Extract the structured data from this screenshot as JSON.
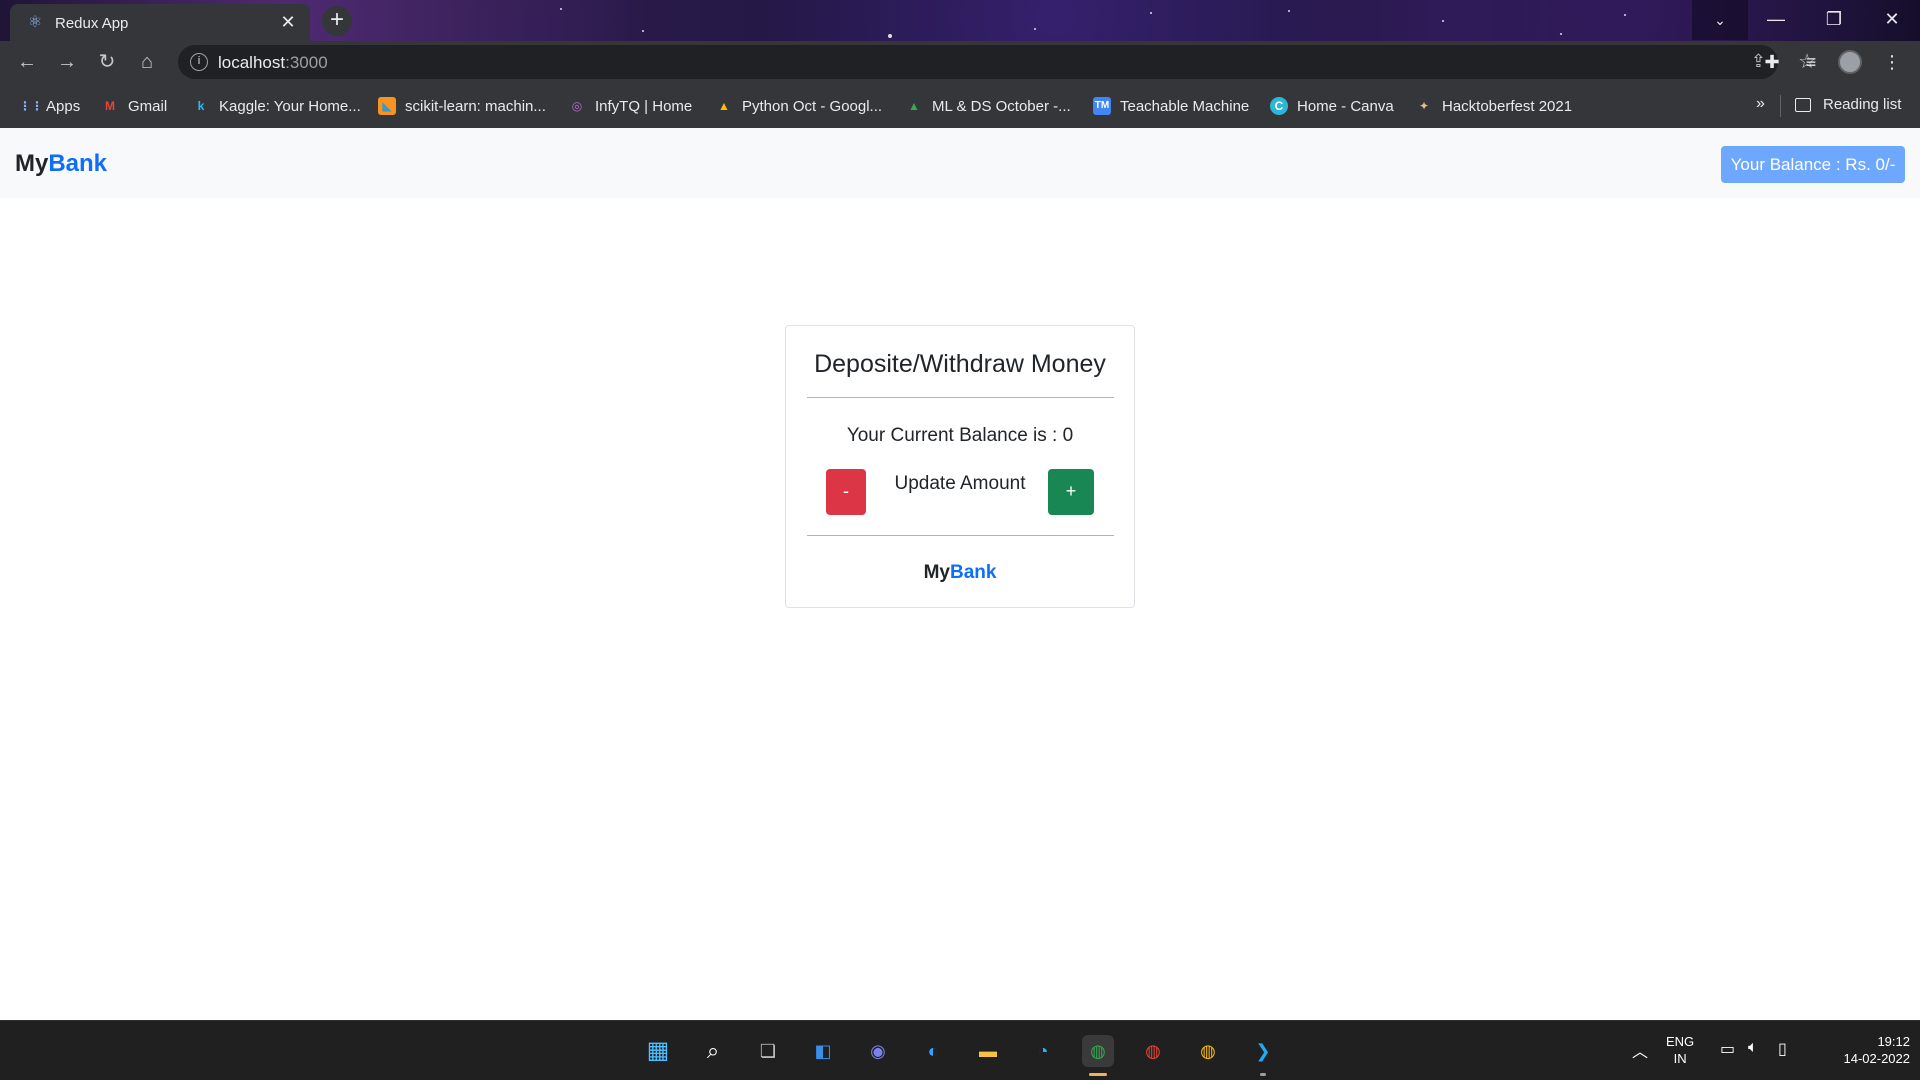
{
  "browser": {
    "tab": {
      "title": "Redux App",
      "icon": "react-icon",
      "close_glyph": "✕"
    },
    "new_tab_glyph": "+",
    "window_controls": {
      "tab_search": "⌄",
      "minimize": "—",
      "restore": "❐",
      "close": "✕"
    },
    "nav": {
      "back": "←",
      "forward": "→",
      "reload": "↻",
      "home": "⌂"
    },
    "address": {
      "host": "localhost",
      "port": ":3000"
    },
    "bookmarks": [
      {
        "label": "Apps",
        "icon": "apps-grid-icon"
      },
      {
        "label": "Gmail",
        "icon": "gmail-icon"
      },
      {
        "label": "Kaggle: Your Home...",
        "icon": "kaggle-icon"
      },
      {
        "label": "scikit-learn: machin...",
        "icon": "scikit-learn-icon"
      },
      {
        "label": "InfyTQ | Home",
        "icon": "infytq-icon"
      },
      {
        "label": "Python Oct - Googl...",
        "icon": "google-drive-icon"
      },
      {
        "label": "ML & DS October -...",
        "icon": "google-drive-icon"
      },
      {
        "label": "Teachable Machine",
        "icon": "teachable-machine-icon"
      },
      {
        "label": "Home - Canva",
        "icon": "canva-icon"
      },
      {
        "label": "Hacktoberfest 2021",
        "icon": "hacktoberfest-icon"
      }
    ],
    "bookmarks_overflow": "»",
    "reading_list": "Reading list"
  },
  "navbar": {
    "brand_prefix": "My",
    "brand_accent": "Bank",
    "balance_button": "Your Balance : Rs. 0/-"
  },
  "card": {
    "title": "Deposite/Withdraw Money",
    "balance_text": "Your Current Balance is : 0",
    "minus_label": "-",
    "plus_label": "+",
    "update_label": "Update Amount",
    "footer_prefix": "My",
    "footer_accent": "Bank"
  },
  "taskbar": {
    "language_line1": "ENG",
    "language_line2": "IN",
    "time": "19:12",
    "date": "14-02-2022"
  },
  "colors": {
    "brand_accent": "#0d6efd",
    "balance_button": "#6ea8fe",
    "danger": "#dc3545",
    "success": "#198754"
  }
}
